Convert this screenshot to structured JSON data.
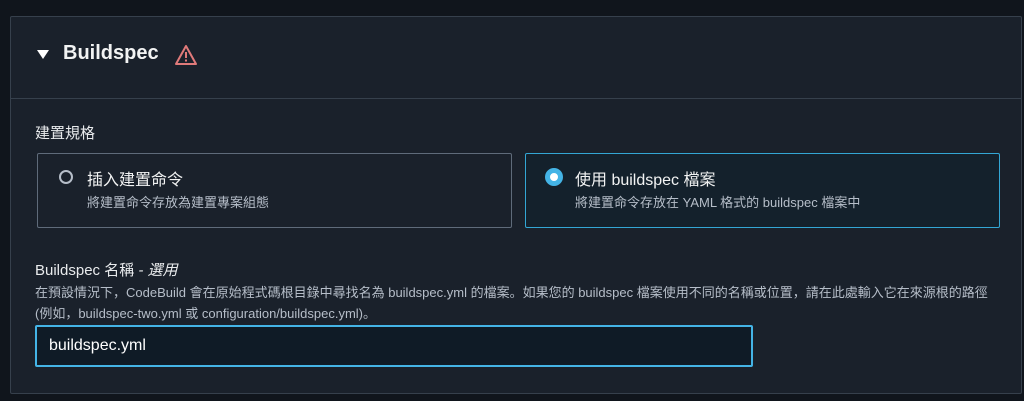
{
  "section": {
    "title": "Buildspec",
    "warning_icon": "warning-triangle-icon",
    "warning_color": "#e07a7a"
  },
  "build_spec": {
    "label": "建置規格",
    "options": [
      {
        "title": "插入建置命令",
        "description": "將建置命令存放為建置專案組態",
        "selected": false
      },
      {
        "title": "使用 buildspec 檔案",
        "description": "將建置命令存放在 YAML 格式的 buildspec 檔案中",
        "selected": true
      }
    ]
  },
  "buildspec_name": {
    "label": "Buildspec 名稱",
    "optional": "- 選用",
    "description": "在預設情況下，CodeBuild 會在原始程式碼根目錄中尋找名為 buildspec.yml 的檔案。如果您的 buildspec 檔案使用不同的名稱或位置，請在此處輸入它在來源根的路徑 (例如，buildspec-two.yml 或 configuration/buildspec.yml)。",
    "value": "buildspec.yml"
  },
  "colors": {
    "accent": "#44b4e6",
    "background": "#1a212b"
  }
}
